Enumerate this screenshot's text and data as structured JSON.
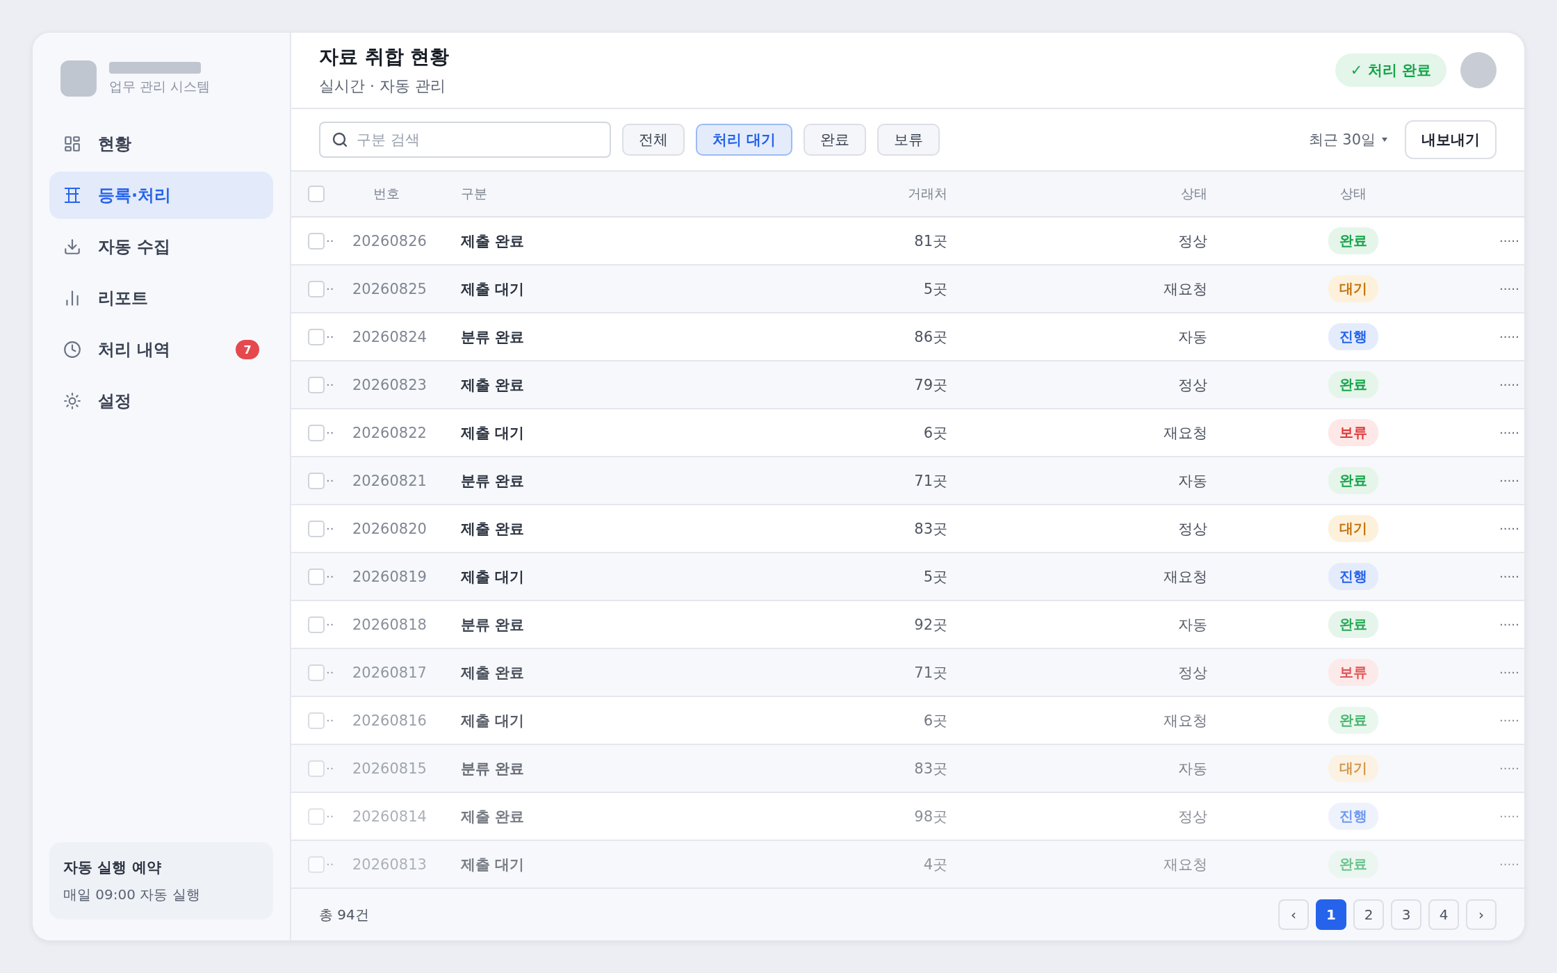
{
  "sidebar": {
    "subtitle": "업무 관리 시스템",
    "items": [
      {
        "label": "현황",
        "selected": false
      },
      {
        "label": "등록·처리",
        "selected": true
      },
      {
        "label": "자동 수집",
        "selected": false
      },
      {
        "label": "리포트",
        "selected": false
      },
      {
        "label": "처리 내역",
        "selected": false,
        "badge": "7"
      },
      {
        "label": "설정",
        "selected": false
      }
    ],
    "schedule": {
      "title": "자동 실행 예약",
      "text": "매일 09:00 자동 실행"
    }
  },
  "header": {
    "title": "자료 취합 현황",
    "subtitle": "실시간 · 자동 관리",
    "status": "✓ 처리 완료"
  },
  "toolbar": {
    "search": {
      "placeholder": "구분 검색"
    },
    "filters": [
      {
        "label": "전체",
        "selected": false
      },
      {
        "label": "처리 대기",
        "selected": true
      },
      {
        "label": "완료",
        "selected": false
      },
      {
        "label": "보류",
        "selected": false
      }
    ],
    "period": "최근 30일",
    "export": "내보내기"
  },
  "table": {
    "header_checked": false,
    "columns": [
      "번호",
      "구분",
      "거래처",
      "상태",
      "상태"
    ],
    "rows": [
      {
        "checked": false,
        "marker": "··",
        "no": "20260826",
        "type": "제출 완료",
        "partner": "81곳",
        "state": "정상",
        "status": {
          "label": "완료",
          "kind": "done"
        },
        "more": "·····"
      },
      {
        "checked": false,
        "marker": "··",
        "no": "20260825",
        "type": "제출 대기",
        "partner": "5곳",
        "state": "재요청",
        "status": {
          "label": "대기",
          "kind": "wait"
        },
        "more": "·····"
      },
      {
        "checked": false,
        "marker": "··",
        "no": "20260824",
        "type": "분류 완료",
        "partner": "86곳",
        "state": "자동",
        "status": {
          "label": "진행",
          "kind": "progress"
        },
        "more": "·····"
      },
      {
        "checked": false,
        "marker": "··",
        "no": "20260823",
        "type": "제출 완료",
        "partner": "79곳",
        "state": "정상",
        "status": {
          "label": "완료",
          "kind": "done"
        },
        "more": "·····"
      },
      {
        "checked": false,
        "marker": "··",
        "no": "20260822",
        "type": "제출 대기",
        "partner": "6곳",
        "state": "재요청",
        "status": {
          "label": "보류",
          "kind": "hold"
        },
        "more": "·····"
      },
      {
        "checked": false,
        "marker": "··",
        "no": "20260821",
        "type": "분류 완료",
        "partner": "71곳",
        "state": "자동",
        "status": {
          "label": "완료",
          "kind": "done"
        },
        "more": "·····"
      },
      {
        "checked": false,
        "marker": "··",
        "no": "20260820",
        "type": "제출 완료",
        "partner": "83곳",
        "state": "정상",
        "status": {
          "label": "대기",
          "kind": "wait"
        },
        "more": "·····"
      },
      {
        "checked": false,
        "marker": "··",
        "no": "20260819",
        "type": "제출 대기",
        "partner": "5곳",
        "state": "재요청",
        "status": {
          "label": "진행",
          "kind": "progress"
        },
        "more": "·····"
      },
      {
        "checked": false,
        "marker": "··",
        "no": "20260818",
        "type": "분류 완료",
        "partner": "92곳",
        "state": "자동",
        "status": {
          "label": "완료",
          "kind": "done"
        },
        "more": "·····"
      },
      {
        "checked": false,
        "marker": "··",
        "no": "20260817",
        "type": "제출 완료",
        "partner": "71곳",
        "state": "정상",
        "status": {
          "label": "보류",
          "kind": "hold"
        },
        "more": "·····"
      },
      {
        "checked": false,
        "marker": "··",
        "no": "20260816",
        "type": "제출 대기",
        "partner": "6곳",
        "state": "재요청",
        "status": {
          "label": "완료",
          "kind": "done"
        },
        "more": "·····"
      },
      {
        "checked": false,
        "marker": "··",
        "no": "20260815",
        "type": "분류 완료",
        "partner": "83곳",
        "state": "자동",
        "status": {
          "label": "대기",
          "kind": "wait"
        },
        "more": "·····"
      },
      {
        "checked": false,
        "marker": "··",
        "no": "20260814",
        "type": "제출 완료",
        "partner": "98곳",
        "state": "정상",
        "status": {
          "label": "진행",
          "kind": "progress"
        },
        "more": "·····"
      },
      {
        "checked": false,
        "marker": "··",
        "no": "20260813",
        "type": "제출 대기",
        "partner": "4곳",
        "state": "재요청",
        "status": {
          "label": "완료",
          "kind": "done"
        },
        "more": "·····"
      }
    ]
  },
  "footer": {
    "total": "총 94건",
    "pages": [
      {
        "label": "‹",
        "selected": false
      },
      {
        "label": "1",
        "selected": true
      },
      {
        "label": "2",
        "selected": false
      },
      {
        "label": "3",
        "selected": false
      },
      {
        "label": "4",
        "selected": false
      },
      {
        "label": "›",
        "selected": false
      }
    ]
  }
}
